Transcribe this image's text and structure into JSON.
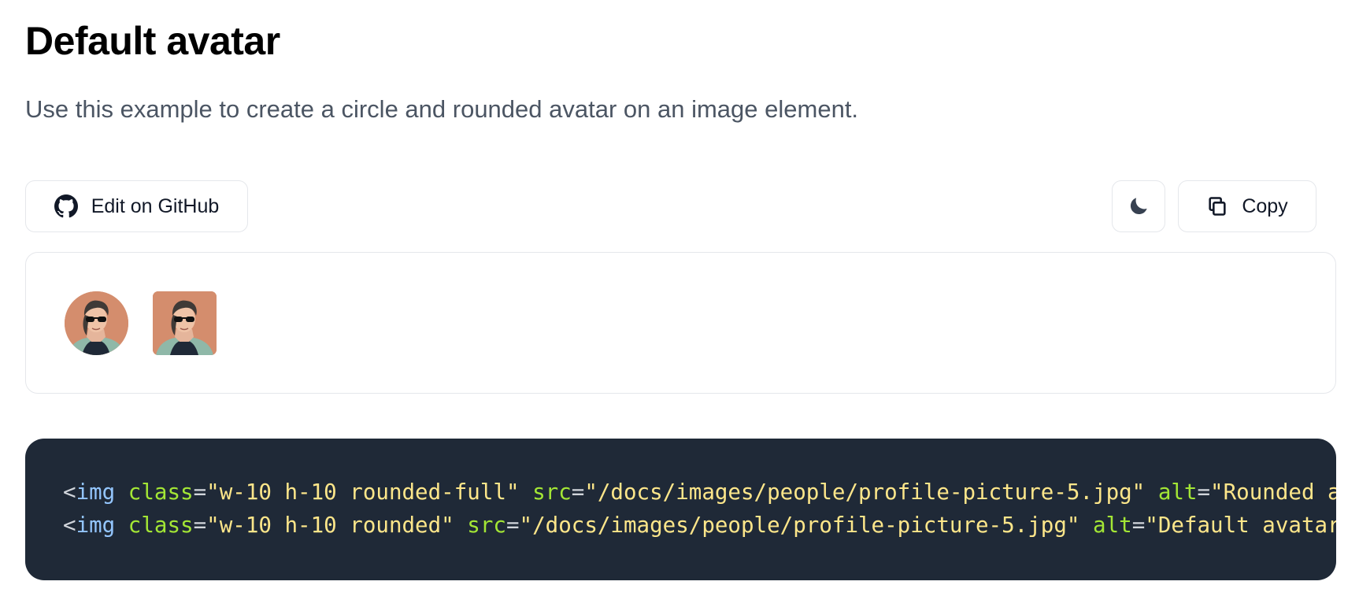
{
  "header": {
    "title": "Default avatar",
    "description": "Use this example to create a circle and rounded avatar on an image element."
  },
  "toolbar": {
    "github_label": "Edit on GitHub",
    "theme_icon": "moon-icon",
    "copy_label": "Copy",
    "copy_icon": "copy-icon"
  },
  "preview": {
    "avatars": [
      {
        "shape": "circle",
        "alt": "Rounded avatar"
      },
      {
        "shape": "rounded",
        "alt": "Default avatar"
      }
    ]
  },
  "code": {
    "lines": [
      {
        "open": "<",
        "tag": "img",
        "attr1": "class",
        "eq1": "=",
        "val1": "\"w-10 h-10 rounded-full\"",
        "attr2": "src",
        "eq2": "=",
        "val2": "\"/docs/images/people/profile-picture-5.jpg\"",
        "attr3": "alt",
        "eq3": "=",
        "val3": "\"Rounded avatar\">"
      },
      {
        "open": "<",
        "tag": "img",
        "attr1": "class",
        "eq1": "=",
        "val1": "\"w-10 h-10 rounded\"",
        "attr2": "src",
        "eq2": "=",
        "val2": "\"/docs/images/people/profile-picture-5.jpg\"",
        "attr3": "alt",
        "eq3": "=",
        "val3": "\"Default avatar\">"
      }
    ]
  },
  "colors": {
    "code_bg": "#1f2937",
    "tag": "#93c5fd",
    "attribute": "#a3e635",
    "string": "#fde68a",
    "avatar_bg": "#d48d6d"
  }
}
